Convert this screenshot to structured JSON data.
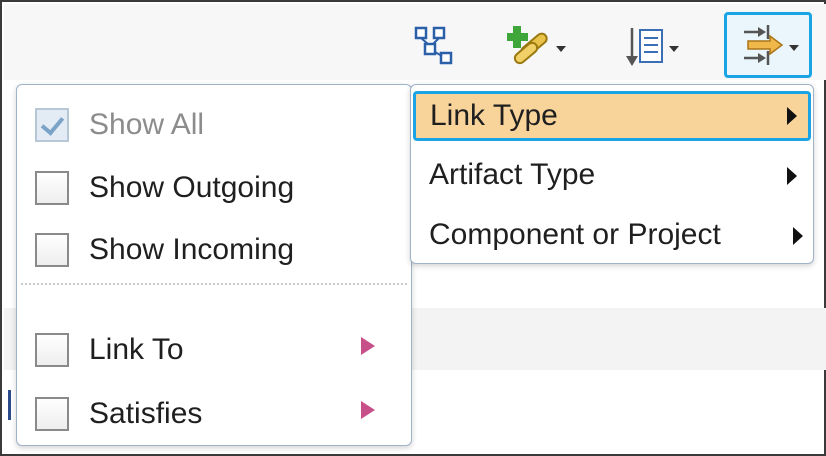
{
  "toolbar": {
    "buttons": [
      {
        "icon": "graph-nodes-icon",
        "has_dropdown": false
      },
      {
        "icon": "add-link-icon",
        "has_dropdown": true
      },
      {
        "icon": "sort-list-icon",
        "has_dropdown": true
      },
      {
        "icon": "link-direction-filter-icon",
        "has_dropdown": true,
        "active": true
      }
    ]
  },
  "filter_menu": {
    "show_all": {
      "label": "Show All",
      "checked": true,
      "disabled": true
    },
    "show_outgoing": {
      "label": "Show Outgoing",
      "checked": false
    },
    "show_incoming": {
      "label": "Show Incoming",
      "checked": false
    },
    "link_to": {
      "label": "Link To",
      "checked": false,
      "has_submenu": true
    },
    "satisfies": {
      "label": "Satisfies",
      "checked": false,
      "has_submenu": true
    }
  },
  "type_menu": {
    "items": [
      {
        "label": "Link Type",
        "highlighted": true
      },
      {
        "label": "Artifact Type"
      },
      {
        "label": "Component or Project"
      }
    ]
  },
  "colors": {
    "highlight_fill": "#f9d49a",
    "focus_border": "#1aa4e3",
    "submenu_arrow": "#c8508a"
  }
}
